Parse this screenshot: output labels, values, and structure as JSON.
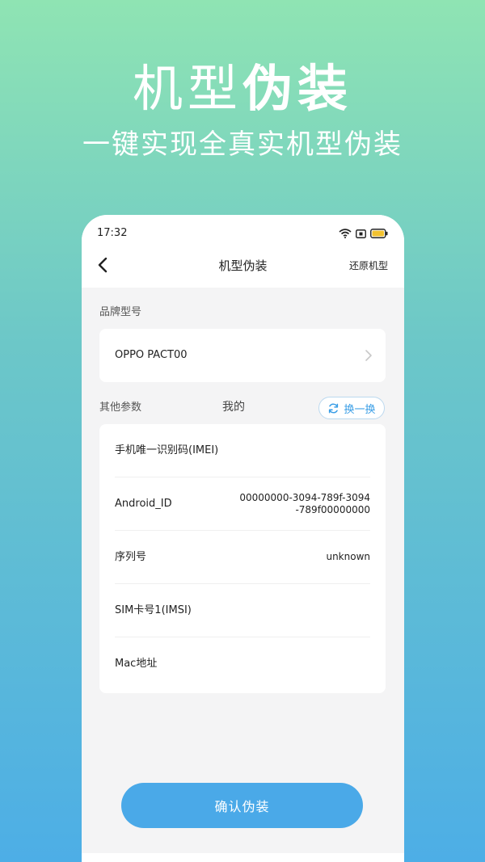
{
  "hero": {
    "title_light": "机型",
    "title_bold": "伪装",
    "subtitle": "一键实现全真实机型伪装"
  },
  "status_bar": {
    "time": "17:32"
  },
  "nav": {
    "title": "机型伪装",
    "action": "还原机型"
  },
  "brand_section": {
    "label": "品牌型号",
    "value": "OPPO PACT00"
  },
  "params_section": {
    "label": "其他参数",
    "tab": "我的",
    "swap_label": "换一换",
    "rows": [
      {
        "label": "手机唯一识别码(IMEI)",
        "value": ""
      },
      {
        "label": "Android_ID",
        "value": "00000000-3094-789f-3094-789f00000000"
      },
      {
        "label": "序列号",
        "value": "unknown"
      },
      {
        "label": "SIM卡号1(IMSI)",
        "value": ""
      },
      {
        "label": "Mac地址",
        "value": ""
      }
    ]
  },
  "confirm_label": "确认伪装",
  "colors": {
    "accent": "#4aa9e8",
    "gradient_top": "#8fe4b3",
    "gradient_bottom": "#4daee6",
    "battery": "#f2c230"
  },
  "icons": {
    "back": "chevron-left-icon",
    "wifi": "wifi-icon",
    "sim": "sim-icon",
    "battery": "battery-icon",
    "brand_chevron": "chevron-right-icon",
    "swap": "refresh-icon"
  }
}
